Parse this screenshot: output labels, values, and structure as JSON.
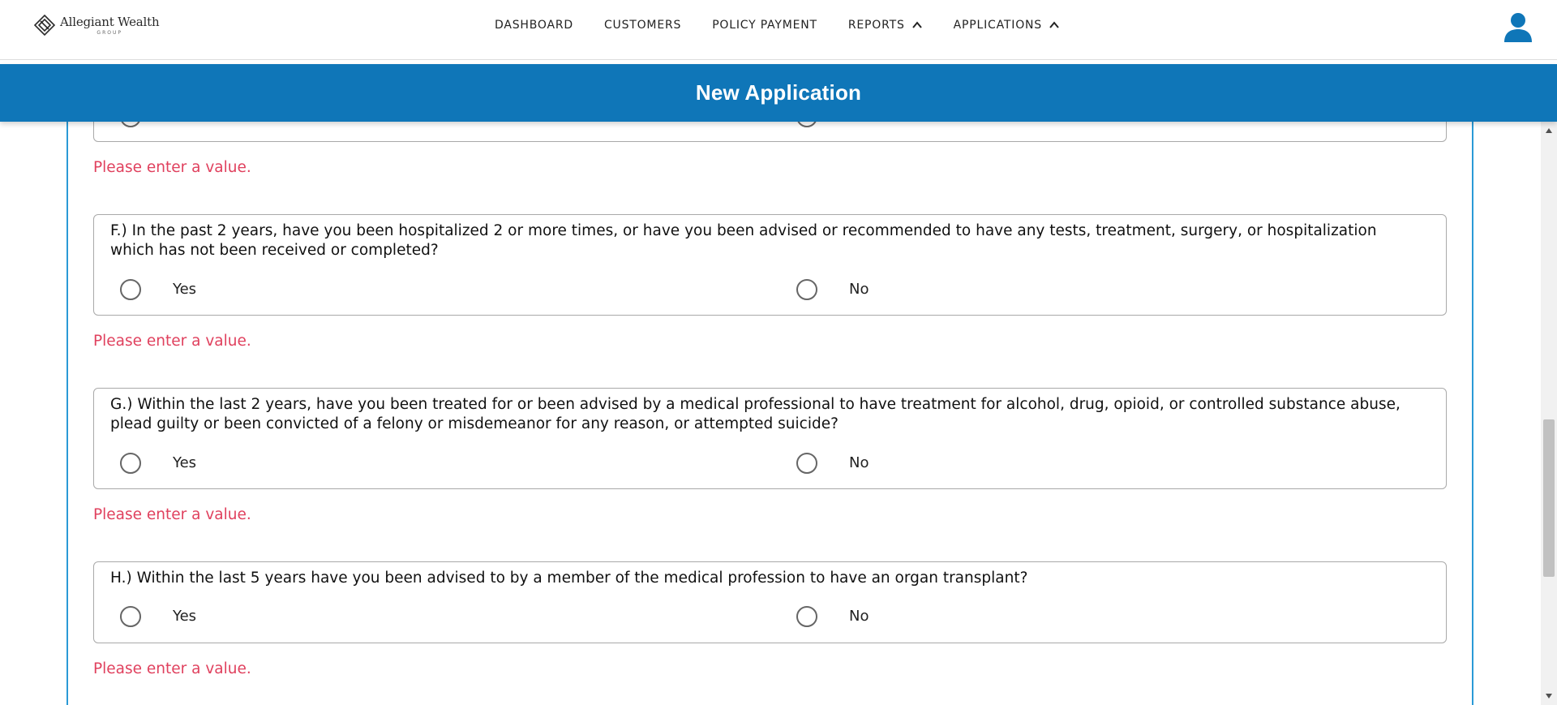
{
  "brand": {
    "name": "Allegiant Wealth",
    "sub": "GROUP"
  },
  "nav": {
    "items": [
      {
        "label": "DASHBOARD"
      },
      {
        "label": "CUSTOMERS"
      },
      {
        "label": "POLICY PAYMENT"
      },
      {
        "label": "REPORTS",
        "chevron": "chevron-up-icon"
      },
      {
        "label": "APPLICATIONS",
        "chevron": "chevron-up-icon"
      }
    ],
    "user_icon": "user-icon"
  },
  "page": {
    "title": "New Application"
  },
  "colors": {
    "header_blue": "#0f76b8",
    "frame_blue": "#2a9ad6",
    "error_red": "#e0415e"
  },
  "form": {
    "error_message": "Please enter a value.",
    "yes_label": "Yes",
    "no_label": "No",
    "questions": [
      {
        "text": "F.) In the past 2 years, have you been hospitalized 2 or more times, or have you been advised or recommended to have any tests, treatment, surgery, or hospitalization which has not been received or completed?"
      },
      {
        "text": "G.) Within the last 2 years, have you been treated for or been advised by a medical professional to have treatment for alcohol, drug, opioid, or controlled substance abuse, plead guilty or been convicted of a felony or misdemeanor for any reason, or attempted suicide?"
      },
      {
        "text": "H.) Within the last 5 years have you been advised to by a member of the medical profession to have an organ transplant?"
      }
    ]
  }
}
